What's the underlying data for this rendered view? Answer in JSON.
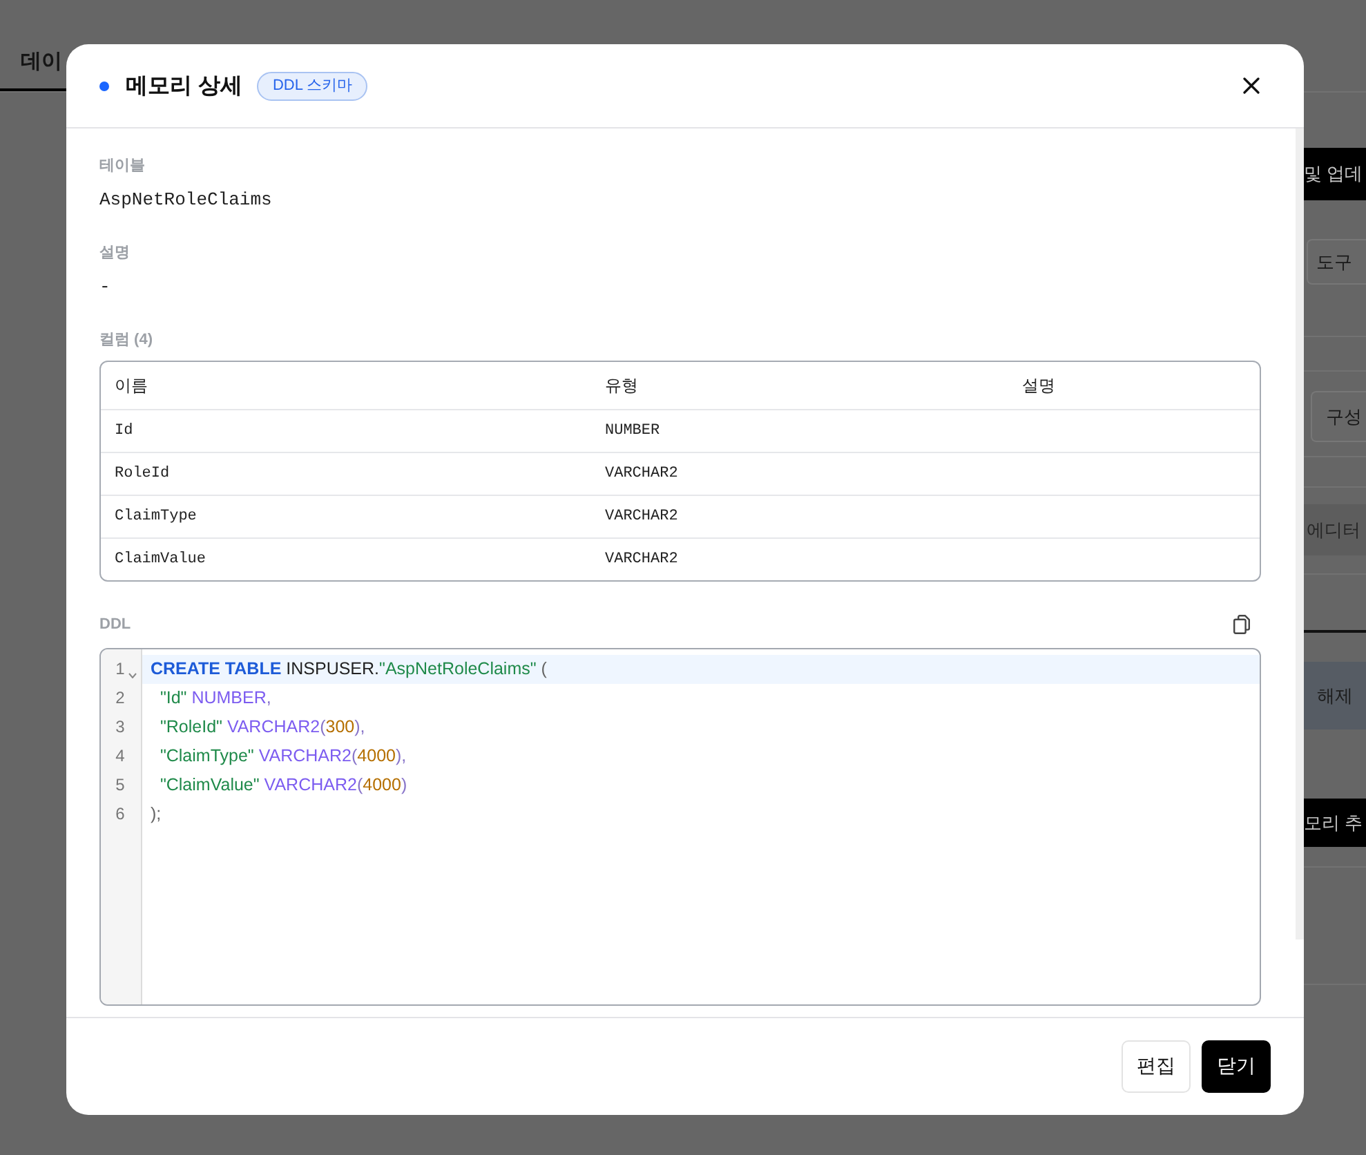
{
  "background": {
    "tab": {
      "label": "데이",
      "selected": true
    },
    "side_buttons": [
      {
        "label": "및 업데",
        "kind": "dark"
      },
      {
        "label": "도구",
        "kind": "outline"
      },
      {
        "label": "구성",
        "kind": "outline"
      },
      {
        "label": "에디터",
        "kind": "muted"
      },
      {
        "label": "해제",
        "kind": "tinted"
      },
      {
        "label": "모리 추",
        "kind": "dark"
      }
    ]
  },
  "dialog": {
    "title": "메모리 상세",
    "badge": "DDL 스키마",
    "fields": [
      {
        "label": "테이블",
        "value": "AspNetRoleClaims"
      },
      {
        "label": "설명",
        "value": "-"
      }
    ],
    "columns_section": {
      "label": "컬럼 (4)",
      "table": {
        "columns": [
          "이름",
          "유형",
          "설명"
        ],
        "rows": [
          [
            "Id",
            "NUMBER"
          ],
          [
            "RoleId",
            "VARCHAR2"
          ],
          [
            "ClaimType",
            "VARCHAR2"
          ],
          [
            "ClaimValue",
            "VARCHAR2"
          ]
        ]
      }
    },
    "ddl": {
      "label": "DDL",
      "lines": [
        {
          "number": "1",
          "foldable": true,
          "active": true,
          "tokens": [
            {
              "text": "CREATE TABLE",
              "kind": "keyword"
            },
            {
              "text": " INSPUSER.",
              "kind": "plain"
            },
            {
              "text": "\"AspNetRoleClaims\"",
              "kind": "string"
            },
            {
              "text": " (",
              "kind": "punct"
            }
          ]
        },
        {
          "number": "2",
          "foldable": false,
          "active": false,
          "tokens": [
            {
              "text": "  \"Id\" ",
              "kind": "string"
            },
            {
              "text": "NUMBER",
              "kind": "type"
            },
            {
              "text": ",",
              "kind": "bracket"
            }
          ]
        },
        {
          "number": "3",
          "foldable": false,
          "active": false,
          "tokens": [
            {
              "text": "  \"RoleId\" ",
              "kind": "string"
            },
            {
              "text": "VARCHAR2",
              "kind": "type"
            },
            {
              "text": "(",
              "kind": "bracket"
            },
            {
              "text": "300",
              "kind": "number"
            },
            {
              "text": "),",
              "kind": "bracket"
            }
          ]
        },
        {
          "number": "4",
          "foldable": false,
          "active": false,
          "tokens": [
            {
              "text": "  \"ClaimType\" ",
              "kind": "string"
            },
            {
              "text": "VARCHAR2",
              "kind": "type"
            },
            {
              "text": "(",
              "kind": "bracket"
            },
            {
              "text": "4000",
              "kind": "number"
            },
            {
              "text": "),",
              "kind": "bracket"
            }
          ]
        },
        {
          "number": "5",
          "foldable": false,
          "active": false,
          "tokens": [
            {
              "text": "  \"ClaimValue\" ",
              "kind": "string"
            },
            {
              "text": "VARCHAR2",
              "kind": "type"
            },
            {
              "text": "(",
              "kind": "bracket"
            },
            {
              "text": "4000",
              "kind": "number"
            },
            {
              "text": ")",
              "kind": "bracket"
            }
          ]
        },
        {
          "number": "6",
          "foldable": false,
          "active": false,
          "tokens": [
            {
              "text": ");",
              "kind": "punct"
            }
          ]
        }
      ]
    },
    "buttons": [
      {
        "label": "편집",
        "kind": "secondary"
      },
      {
        "label": "닫기",
        "kind": "primary"
      }
    ]
  }
}
